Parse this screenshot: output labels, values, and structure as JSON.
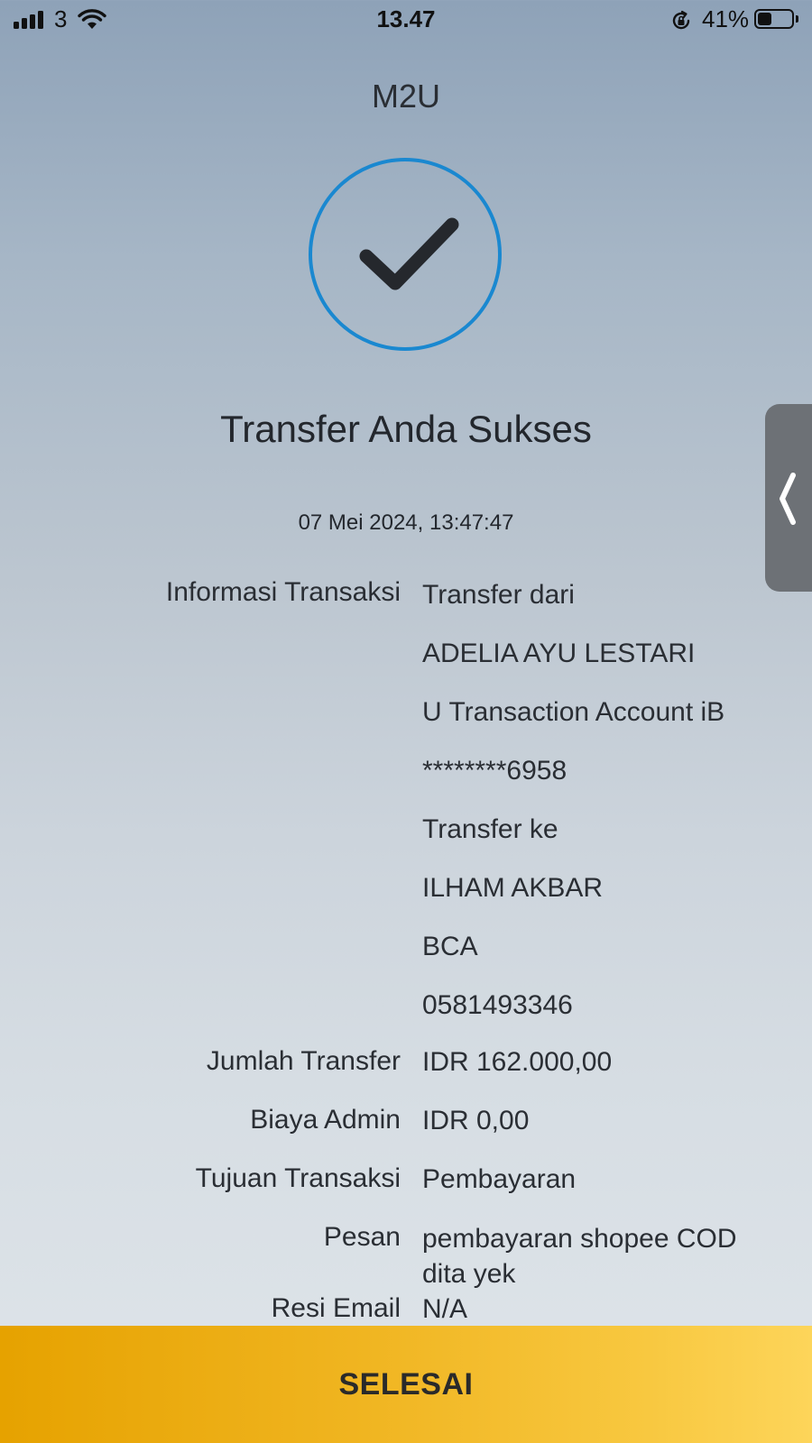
{
  "status_bar": {
    "carrier": "3",
    "time": "13.47",
    "battery_percent": "41%",
    "battery_level": 0.41
  },
  "header": {
    "title": "M2U"
  },
  "result": {
    "title": "Transfer Anda Sukses",
    "timestamp": "07 Mei 2024, 13:47:47",
    "accent_color": "#1a88d0"
  },
  "details": {
    "rows": [
      {
        "label": "Informasi Transaksi",
        "lines": [
          "Transfer dari",
          "ADELIA AYU LESTARI",
          "U Transaction Account iB",
          "********6958",
          "Transfer ke",
          "ILHAM AKBAR",
          "BCA",
          "0581493346"
        ]
      },
      {
        "label": "Jumlah Transfer",
        "lines": [
          "IDR 162.000,00"
        ]
      },
      {
        "label": "Biaya Admin",
        "lines": [
          "IDR 0,00"
        ]
      },
      {
        "label": "Tujuan Transaksi",
        "lines": [
          "Pembayaran"
        ]
      },
      {
        "label": "Pesan",
        "lines": [
          "pembayaran shopee COD",
          "dita yek"
        ]
      },
      {
        "label": "Resi Email",
        "lines": [
          "N/A"
        ]
      }
    ]
  },
  "actions": {
    "done_label": "SELESAI",
    "button_color": "#f0b521"
  },
  "icons": {
    "success": "checkmark-icon",
    "side_panel": "chevron-left-icon"
  }
}
